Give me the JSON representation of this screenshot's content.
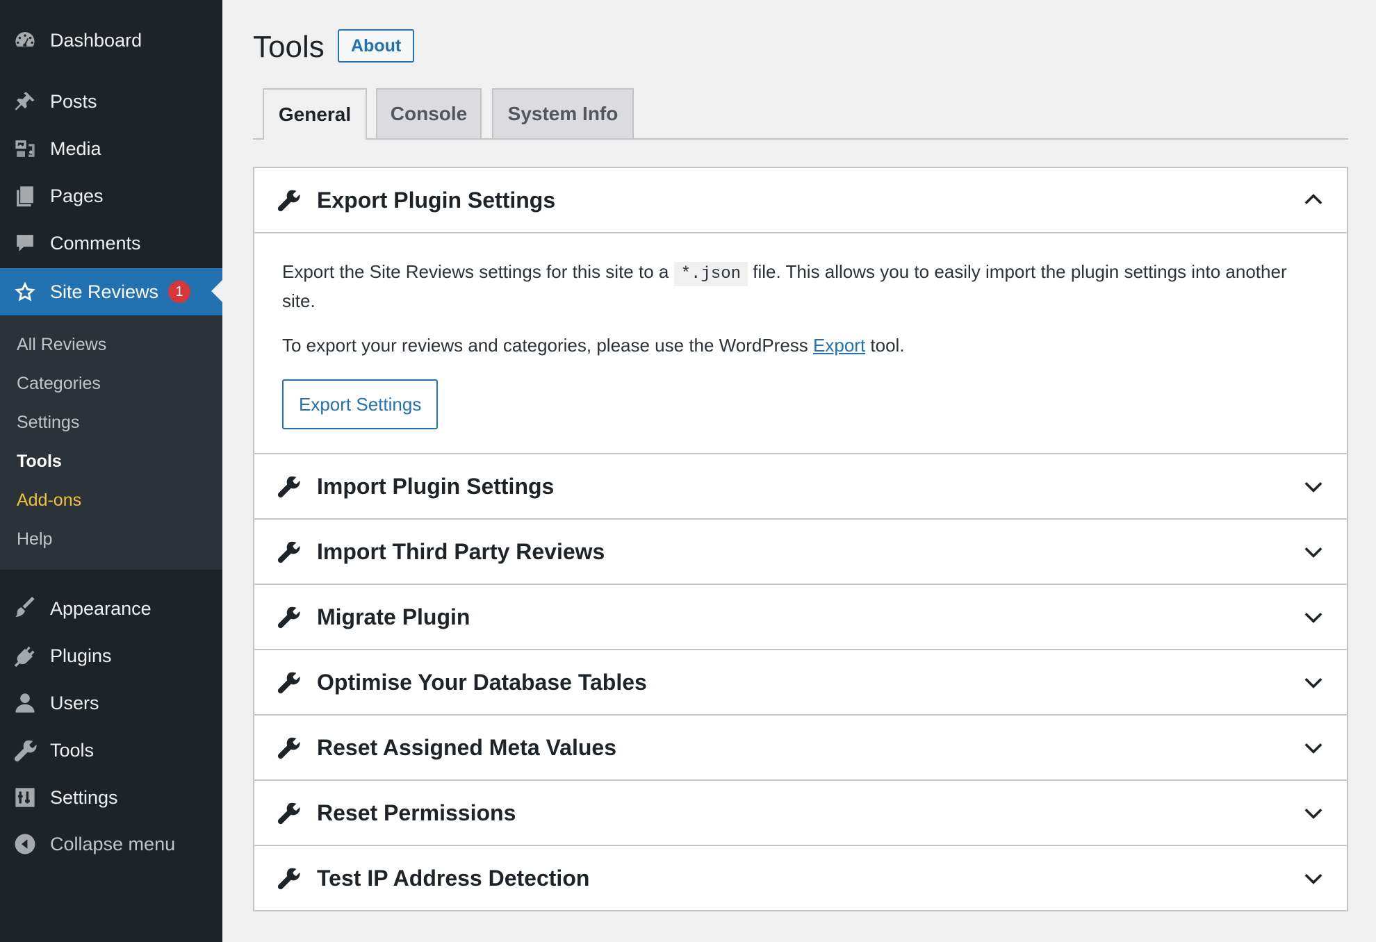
{
  "sidebar": {
    "menu": [
      {
        "id": "dashboard",
        "label": "Dashboard",
        "icon": "dashboard-icon"
      },
      {
        "id": "posts",
        "label": "Posts",
        "icon": "pin-icon"
      },
      {
        "id": "media",
        "label": "Media",
        "icon": "media-icon"
      },
      {
        "id": "pages",
        "label": "Pages",
        "icon": "pages-icon"
      },
      {
        "id": "comments",
        "label": "Comments",
        "icon": "comment-icon"
      },
      {
        "id": "site-reviews",
        "label": "Site Reviews",
        "icon": "star-icon",
        "badge": "1",
        "current": true
      },
      {
        "id": "appearance",
        "label": "Appearance",
        "icon": "paintbrush-icon"
      },
      {
        "id": "plugins",
        "label": "Plugins",
        "icon": "plugin-icon"
      },
      {
        "id": "users",
        "label": "Users",
        "icon": "user-icon"
      },
      {
        "id": "tools",
        "label": "Tools",
        "icon": "wrench-icon"
      },
      {
        "id": "settings",
        "label": "Settings",
        "icon": "settings-icon"
      },
      {
        "id": "collapse",
        "label": "Collapse menu",
        "icon": "collapse-icon"
      }
    ],
    "submenu": [
      {
        "label": "All Reviews"
      },
      {
        "label": "Categories"
      },
      {
        "label": "Settings"
      },
      {
        "label": "Tools",
        "active": true
      },
      {
        "label": "Add-ons",
        "highlight": true
      },
      {
        "label": "Help"
      }
    ]
  },
  "header": {
    "title": "Tools",
    "about_label": "About"
  },
  "tabs": [
    {
      "label": "General",
      "active": true
    },
    {
      "label": "Console"
    },
    {
      "label": "System Info"
    }
  ],
  "accordion": {
    "sections": [
      {
        "title": "Export Plugin Settings",
        "expanded": true
      },
      {
        "title": "Import Plugin Settings"
      },
      {
        "title": "Import Third Party Reviews"
      },
      {
        "title": "Migrate Plugin"
      },
      {
        "title": "Optimise Your Database Tables"
      },
      {
        "title": "Reset Assigned Meta Values"
      },
      {
        "title": "Reset Permissions"
      },
      {
        "title": "Test IP Address Detection"
      }
    ],
    "export_body": {
      "p1_before": "Export the Site Reviews settings for this site to a ",
      "p1_code": "*.json",
      "p1_after": " file. This allows you to easily import the plugin settings into another site.",
      "p2_before": "To export your reviews and categories, please use the WordPress ",
      "p2_link": "Export",
      "p2_after": " tool.",
      "button_label": "Export Settings"
    }
  },
  "colors": {
    "sidebar_bg": "#1d2327",
    "submenu_bg": "#2c3338",
    "accent": "#2271b1",
    "badge": "#d63638",
    "highlight": "#f0c33c"
  }
}
